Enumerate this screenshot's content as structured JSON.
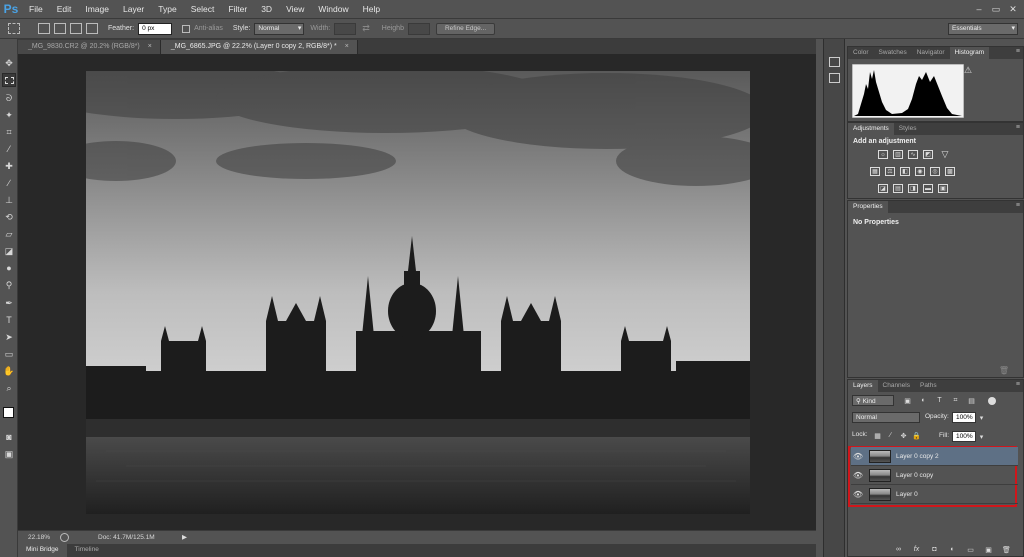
{
  "app": {
    "logo": "Ps",
    "workspace": "Essentials"
  },
  "menu": [
    "File",
    "Edit",
    "Image",
    "Layer",
    "Type",
    "Select",
    "Filter",
    "3D",
    "View",
    "Window",
    "Help"
  ],
  "window_controls": {
    "minimize": "–",
    "restore": "▭",
    "close": "✕"
  },
  "options": {
    "feather_label": "Feather:",
    "feather_value": "0 px",
    "antialias_label": "Anti-alias",
    "style_label": "Style:",
    "style_value": "Normal",
    "width_label": "Width:",
    "height_label": "Heighb",
    "refine_edge": "Refine Edge..."
  },
  "tabs": [
    {
      "label": "_MG_9830.CR2 @ 20.2% (RGB/8*)",
      "close": "×"
    },
    {
      "label": "_MG_6865.JPG @ 22.2% (Layer 0 copy 2, RGB/8*) *",
      "close": "×"
    }
  ],
  "status": {
    "zoom": "22.18%",
    "doc": "Doc: 41.7M/125.1M"
  },
  "bottom_tabs": [
    "Mini Bridge",
    "Timeline"
  ],
  "panels": {
    "histogram_tabs": [
      "Color",
      "Swatches",
      "Navigator",
      "Histogram"
    ],
    "histogram_warning": "⚠",
    "adjustments_tabs": [
      "Adjustments",
      "Styles"
    ],
    "adjustments_title": "Add an adjustment",
    "properties_tab": "Properties",
    "properties_text": "No Properties",
    "layers_tabs": [
      "Layers",
      "Channels",
      "Paths"
    ],
    "kind_label": "Kind",
    "blend_mode": "Normal",
    "opacity_label": "Opacity:",
    "opacity_value": "100%",
    "lock_label": "Lock:",
    "fill_label": "Fill:",
    "fill_value": "100%",
    "layers": [
      {
        "name": "Layer 0 copy 2",
        "selected": true
      },
      {
        "name": "Layer 0 copy",
        "selected": false
      },
      {
        "name": "Layer 0",
        "selected": false
      }
    ]
  },
  "highlight_color": "#d0161b",
  "selected_layer_color": "#5e7085"
}
